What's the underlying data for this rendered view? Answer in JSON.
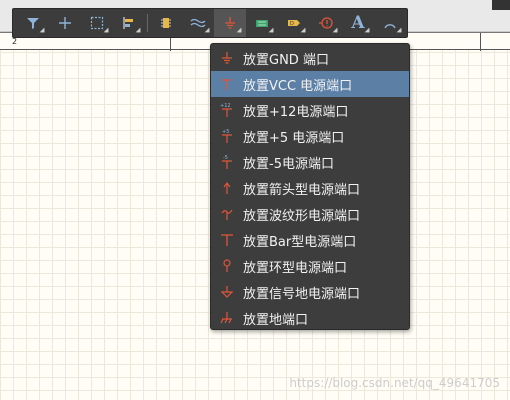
{
  "ruler": {
    "zone_label": "2"
  },
  "toolbar": {
    "buttons": [
      {
        "name": "filter",
        "icon": "filter-icon"
      },
      {
        "name": "cross",
        "icon": "crosshair-icon"
      },
      {
        "name": "select-rect",
        "icon": "select-rect-icon"
      },
      {
        "name": "align",
        "icon": "align-icon"
      },
      {
        "name": "component",
        "icon": "component-icon"
      },
      {
        "name": "wire",
        "icon": "wire-icon"
      },
      {
        "name": "power-port",
        "icon": "power-ground-icon"
      },
      {
        "name": "harness",
        "icon": "harness-icon"
      },
      {
        "name": "port",
        "icon": "port-icon"
      },
      {
        "name": "no-erc",
        "icon": "no-erc-icon"
      },
      {
        "name": "text",
        "icon": "text-icon",
        "glyph": "A"
      },
      {
        "name": "arc",
        "icon": "arc-icon"
      }
    ]
  },
  "menu": {
    "highlight_color": "#5c7fa5",
    "items": [
      {
        "label": "放置GND 端口",
        "icon": "gnd-icon"
      },
      {
        "label": "放置VCC 电源端口",
        "icon": "vcc-icon",
        "highlight": true
      },
      {
        "label": "放置+12电源端口",
        "icon": "plus12-icon",
        "badge": "+12"
      },
      {
        "label": "放置+5 电源端口",
        "icon": "plus5-icon",
        "badge": "+5"
      },
      {
        "label": "放置-5电源端口",
        "icon": "minus5-icon",
        "badge": "-5"
      },
      {
        "label": "放置箭头型电源端口",
        "icon": "arrow-power-icon"
      },
      {
        "label": "放置波纹形电源端口",
        "icon": "wave-power-icon"
      },
      {
        "label": "放置Bar型电源端口",
        "icon": "bar-power-icon"
      },
      {
        "label": "放置环型电源端口",
        "icon": "circle-power-icon"
      },
      {
        "label": "放置信号地电源端口",
        "icon": "signal-ground-icon"
      },
      {
        "label": "放置地端口",
        "icon": "earth-ground-icon"
      }
    ]
  },
  "watermark": "https://blog.csdn.net/qq_49641705",
  "colors": {
    "icon_red": "#e0553a",
    "toolbar_bg": "#3c3c3c",
    "menu_bg": "#3d3d3d"
  }
}
